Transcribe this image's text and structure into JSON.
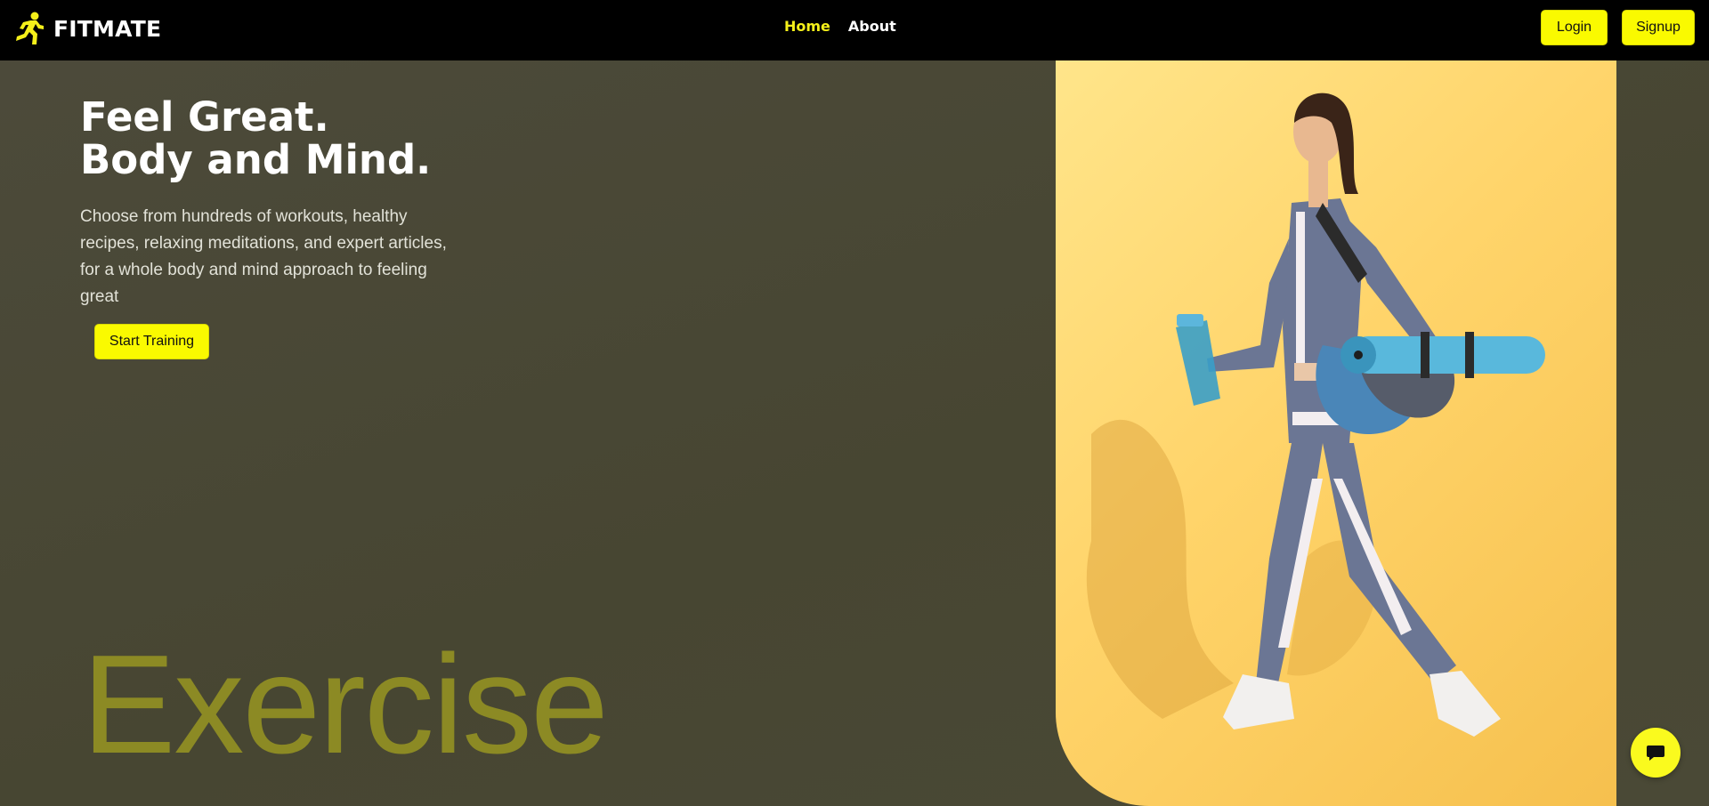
{
  "brand": {
    "name": "FITMATE",
    "logo_icon": "running-person-icon",
    "accent": "#fafa00"
  },
  "nav": {
    "links": [
      {
        "label": "Home",
        "active": true
      },
      {
        "label": "About",
        "active": false
      }
    ],
    "login_label": "Login",
    "signup_label": "Signup"
  },
  "hero": {
    "title_line1": "Feel Great.",
    "title_line2": "Body and Mind.",
    "description": "Choose from hundreds of workouts, healthy recipes, relaxing meditations, and expert articles, for a whole body and mind approach to feeling great",
    "cta_label": "Start Training",
    "big_word": "Exercise",
    "image": "woman-walking-with-yoga-mat-photo"
  },
  "chat": {
    "icon": "chat-bubble-icon"
  }
}
